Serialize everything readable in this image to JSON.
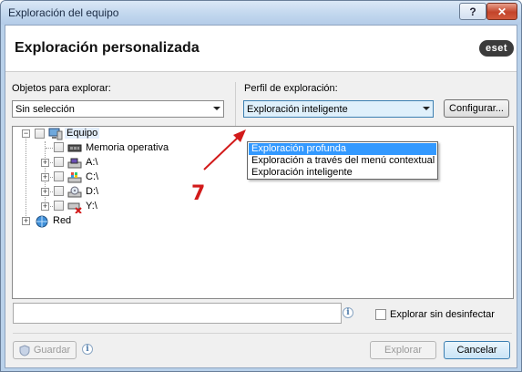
{
  "window": {
    "title": "Exploración del equipo",
    "help_label": "?",
    "close_label": "✕"
  },
  "header": {
    "title": "Exploración personalizada",
    "logo": "eset"
  },
  "objects": {
    "label": "Objetos para explorar:",
    "value": "Sin selección"
  },
  "profile": {
    "label": "Perfil de exploración:",
    "value": "Exploración inteligente",
    "configure_label": "Configurar...",
    "options": [
      "Exploración profunda",
      "Exploración a través del menú contextual",
      "Exploración inteligente"
    ]
  },
  "tree": {
    "equipo": "Equipo",
    "memoria": "Memoria operativa",
    "drive_a": "A:\\",
    "drive_c": "C:\\",
    "drive_d": "D:\\",
    "drive_y": "Y:\\",
    "red": "Red"
  },
  "bottom": {
    "path_value": "",
    "no_clean_label": "Explorar sin desinfectar",
    "save_label": "Guardar",
    "scan_label": "Explorar",
    "cancel_label": "Cancelar"
  },
  "annotation": {
    "number": "7",
    "color": "#d21a1a"
  },
  "icons": {
    "info": "info-icon",
    "shield": "shield-icon",
    "computer": "computer-icon",
    "memory": "memory-chip-icon",
    "drive": "drive-icon",
    "network": "network-icon"
  }
}
